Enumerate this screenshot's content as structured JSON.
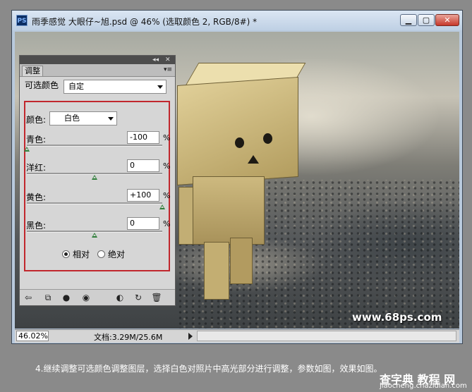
{
  "window": {
    "app_icon": "PS",
    "title": "雨季感觉 大眼仔~旭.psd @ 46% (选取颜色 2, RGB/8#) *",
    "buttons": {
      "minimize": "▁",
      "maximize": "▢",
      "close": "✕"
    }
  },
  "panel": {
    "tab": "调整",
    "selective_color_label": "可选颜色",
    "preset_value": "自定",
    "colors_label": "颜色:",
    "colors_value": "白色",
    "sliders": [
      {
        "label": "青色:",
        "value": "-100",
        "unit": "%",
        "level": -100
      },
      {
        "label": "洋红:",
        "value": "0",
        "unit": "%",
        "level": 0
      },
      {
        "label": "黄色:",
        "value": "+100",
        "unit": "%",
        "level": 100
      },
      {
        "label": "黑色:",
        "value": "0",
        "unit": "%",
        "level": 0
      }
    ],
    "method": {
      "relative": "相对",
      "absolute": "绝对",
      "selected": "relative"
    },
    "footer_icons": [
      "back-arrow-icon",
      "clip-layer-icon",
      "visibility-icon",
      "eye-icon",
      "view-previous-icon",
      "reset-icon",
      "trash-icon"
    ]
  },
  "statusbar": {
    "zoom": "46.02%",
    "doc_info": "文档:3.29M/25.6M"
  },
  "photo_watermark": "www.68ps.com",
  "caption": "4.继续调整可选颜色调整图层，选择白色对照片中高光部分进行调整，参数如图，效果如图。",
  "site_watermark": {
    "line1": "查字典 教程 网",
    "line2": "jiaocheng.chazidian.com"
  }
}
